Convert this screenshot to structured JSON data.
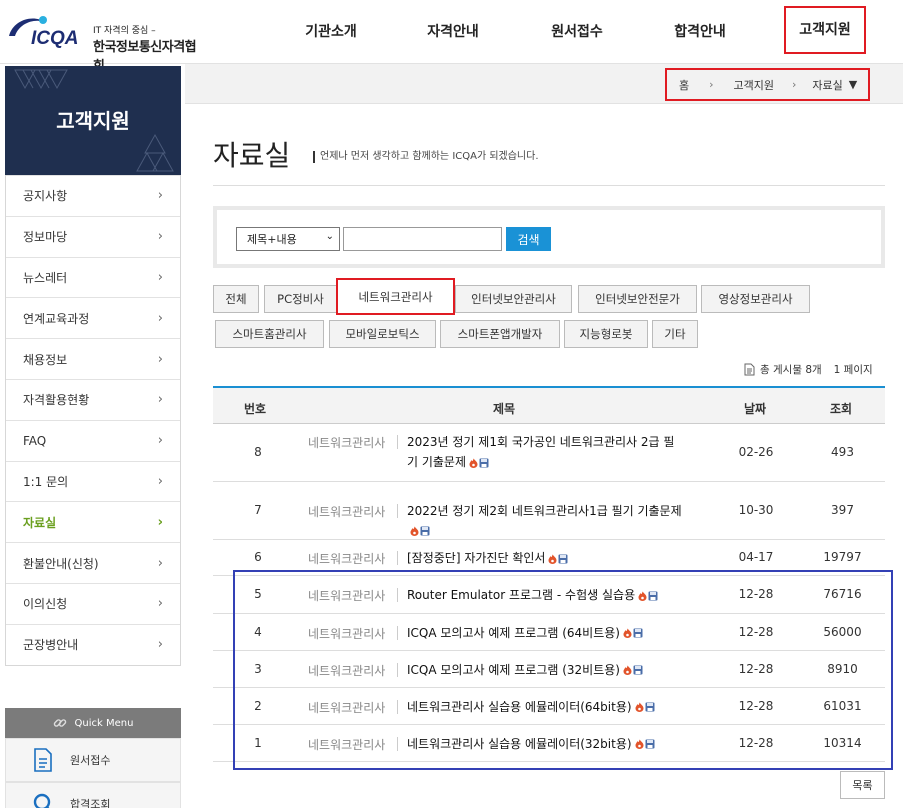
{
  "header": {
    "logo_sub": "IT 자격의 중심 –",
    "logo_brand": "ICQA",
    "logo_name": "한국정보통신자격협회",
    "nav": [
      "기관소개",
      "자격안내",
      "원서접수",
      "합격안내",
      "고객지원"
    ]
  },
  "breadcrumb": {
    "home": "홈",
    "section": "고객지원",
    "current": "자료실"
  },
  "sidebar": {
    "title": "고객지원",
    "items": [
      "공지사항",
      "정보마당",
      "뉴스레터",
      "연계교육과정",
      "채용정보",
      "자격활용현황",
      "FAQ",
      "1:1 문의",
      "자료실",
      "환불안내(신청)",
      "이의신청",
      "군장병안내"
    ],
    "active_index": 8,
    "quick_menu_title": "Quick Menu",
    "quick_items": [
      "원서접수",
      "합격조회"
    ]
  },
  "page": {
    "title": "자료실",
    "description": "언제나 먼저 생각하고 함께하는 ICQA가 되겠습니다."
  },
  "search": {
    "select_value": "제목+내용",
    "input_value": "",
    "button_label": "검색"
  },
  "categories": [
    "전체",
    "PC정비사",
    "네트워크관리사",
    "인터넷보안관리사",
    "인터넷보안전문가",
    "영상정보관리사",
    "스마트홈관리사",
    "모바일로보틱스",
    "스마트폰앱개발자",
    "지능형로봇",
    "기타"
  ],
  "selected_category": "네트워크관리사",
  "board_info": {
    "total": "총 게시물 8개",
    "pages": "1 페이지"
  },
  "table": {
    "headers": {
      "num": "번호",
      "title": "제목",
      "date": "날짜",
      "views": "조회"
    },
    "rows": [
      {
        "num": "8",
        "category": "네트워크관리사",
        "title_line1": "2023년 정기 제1회 국가공인 네트워크관리사 2급 필",
        "title_line2": "기 기출문제",
        "date": "02-26",
        "views": "493"
      },
      {
        "num": "7",
        "category": "네트워크관리사",
        "title_line1": "2022년 정기 제2회 네트워크관리사1급 필기 기출문제",
        "title_line2": "",
        "date": "10-30",
        "views": "397"
      },
      {
        "num": "6",
        "category": "네트워크관리사",
        "title_line1": "[잠정중단] 자가진단 확인서",
        "title_line2": "",
        "date": "04-17",
        "views": "19797"
      },
      {
        "num": "5",
        "category": "네트워크관리사",
        "title_line1": "Router Emulator 프로그램 - 수험생 실습용",
        "title_line2": "",
        "date": "12-28",
        "views": "76716"
      },
      {
        "num": "4",
        "category": "네트워크관리사",
        "title_line1": "ICQA 모의고사 예제 프로그램 (64비트용)",
        "title_line2": "",
        "date": "12-28",
        "views": "56000"
      },
      {
        "num": "3",
        "category": "네트워크관리사",
        "title_line1": "ICQA 모의고사 예제 프로그램 (32비트용)",
        "title_line2": "",
        "date": "12-28",
        "views": "8910"
      },
      {
        "num": "2",
        "category": "네트워크관리사",
        "title_line1": "네트워크관리사 실습용 에뮬레이터(64bit용)",
        "title_line2": "",
        "date": "12-28",
        "views": "61031"
      },
      {
        "num": "1",
        "category": "네트워크관리사",
        "title_line1": "네트워크관리사 실습용 에뮬레이터(32bit용)",
        "title_line2": "",
        "date": "12-28",
        "views": "10314"
      }
    ]
  },
  "list_button": "목록",
  "colors": {
    "accent_red": "#e01b22",
    "accent_blue": "#1a92d6",
    "navy": "#1f2f4f",
    "active_green": "#6a9f1f",
    "outline_blue": "#3340b5"
  }
}
